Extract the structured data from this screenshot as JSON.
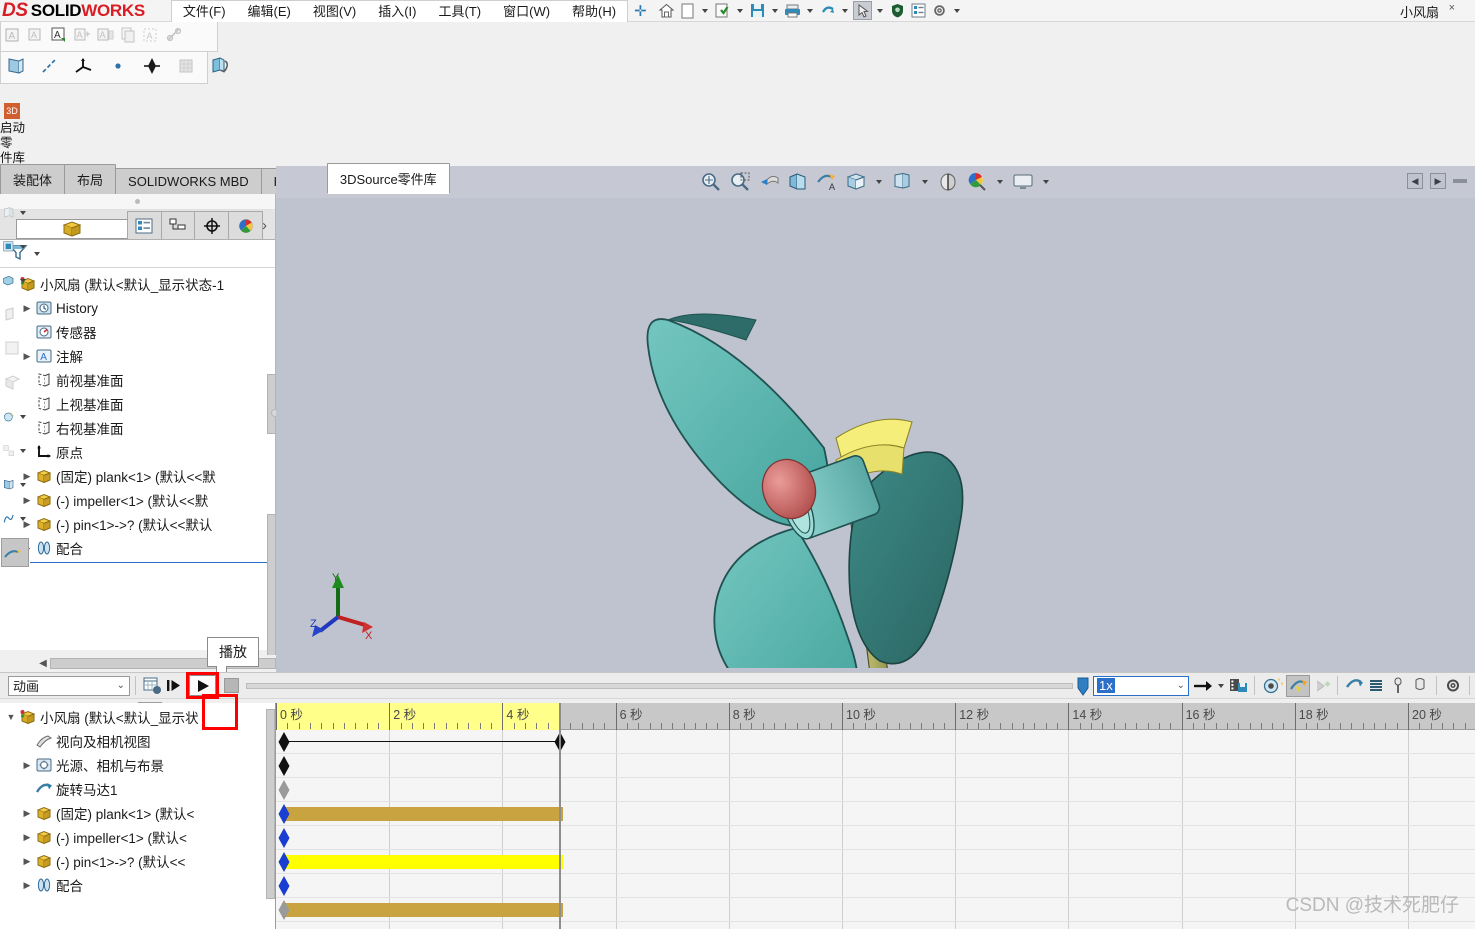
{
  "app": {
    "brand_ds": "DS",
    "brand_solid": "SOLID",
    "brand_works": "WORKS",
    "document_title": "小风扇",
    "close_label": "×",
    "accent_color": "#2a6fc9",
    "highlight_color": "#ff0000"
  },
  "menu": {
    "items": [
      {
        "label": "文件(F)",
        "name": "menu-file"
      },
      {
        "label": "编辑(E)",
        "name": "menu-edit"
      },
      {
        "label": "视图(V)",
        "name": "menu-view"
      },
      {
        "label": "插入(I)",
        "name": "menu-insert"
      },
      {
        "label": "工具(T)",
        "name": "menu-tools"
      },
      {
        "label": "窗口(W)",
        "name": "menu-window"
      },
      {
        "label": "帮助(H)",
        "name": "menu-help"
      }
    ]
  },
  "left_strip": {
    "badge": "3D",
    "label_line1": "启动零",
    "label_line2": "件库"
  },
  "tabs": [
    {
      "label": "装配体",
      "name": "tab-assembly",
      "active": false
    },
    {
      "label": "布局",
      "name": "tab-layout",
      "active": false
    },
    {
      "label": "SOLIDWORKS MBD",
      "name": "tab-solidworks-mbd",
      "active": false
    },
    {
      "label": "KYTool",
      "name": "tab-kytool",
      "active": false
    },
    {
      "label": "3DSource零件库",
      "name": "tab-3dsource-parts-library",
      "active": true
    }
  ],
  "feature_manager": {
    "tabs": [
      {
        "name": "fm-tab-feature-tree",
        "selected": true
      },
      {
        "name": "fm-tab-property-manager",
        "selected": false
      },
      {
        "name": "fm-tab-configuration-manager",
        "selected": false
      },
      {
        "name": "fm-tab-dimxpert-manager",
        "selected": false
      },
      {
        "name": "fm-tab-display-manager",
        "selected": false
      }
    ],
    "more_label": "›",
    "tree": [
      {
        "label": "小风扇  (默认<默认_显示状态-1",
        "indent": 0,
        "expander": "",
        "icon": "assembly-icon",
        "name": "tree-node-assembly-root"
      },
      {
        "label": "History",
        "indent": 1,
        "expander": "▶",
        "icon": "history-icon",
        "name": "tree-node-history"
      },
      {
        "label": "传感器",
        "indent": 1,
        "expander": "",
        "icon": "sensor-icon",
        "name": "tree-node-sensors"
      },
      {
        "label": "注解",
        "indent": 1,
        "expander": "▶",
        "icon": "annotation-icon",
        "name": "tree-node-annotations"
      },
      {
        "label": "前视基准面",
        "indent": 1,
        "expander": "",
        "icon": "plane-icon",
        "name": "tree-node-front-plane"
      },
      {
        "label": "上视基准面",
        "indent": 1,
        "expander": "",
        "icon": "plane-icon",
        "name": "tree-node-top-plane"
      },
      {
        "label": "右视基准面",
        "indent": 1,
        "expander": "",
        "icon": "plane-icon",
        "name": "tree-node-right-plane"
      },
      {
        "label": "原点",
        "indent": 1,
        "expander": "",
        "icon": "origin-icon",
        "name": "tree-node-origin"
      },
      {
        "label": "(固定) plank<1>  (默认<<默",
        "indent": 1,
        "expander": "▶",
        "icon": "part-icon",
        "name": "tree-node-plank"
      },
      {
        "label": "(-) impeller<1>  (默认<<默",
        "indent": 1,
        "expander": "▶",
        "icon": "part-icon",
        "name": "tree-node-impeller"
      },
      {
        "label": "(-) pin<1>->? (默认<<默认",
        "indent": 1,
        "expander": "▶",
        "icon": "part-icon",
        "name": "tree-node-pin"
      },
      {
        "label": "配合",
        "indent": 1,
        "expander": "▶",
        "icon": "mates-icon",
        "name": "tree-node-mates"
      }
    ]
  },
  "graphics": {
    "view_toolbar": [
      {
        "name": "zoom-to-fit-icon",
        "caret": false
      },
      {
        "name": "zoom-to-area-icon",
        "caret": false
      },
      {
        "name": "previous-view-icon",
        "caret": false
      },
      {
        "name": "section-view-icon",
        "caret": false
      },
      {
        "name": "view-orientation-icon",
        "caret": false
      },
      {
        "name": "display-style-icon",
        "caret": true
      },
      {
        "name": "hide-show-items-icon",
        "caret": true
      },
      {
        "name": "edit-appearance-icon",
        "caret": false
      },
      {
        "name": "apply-scene-icon",
        "caret": true
      },
      {
        "name": "view-settings-icon",
        "caret": true
      }
    ],
    "panel_controls": [
      {
        "name": "collapse-left-panel-button",
        "glyph": "◀"
      },
      {
        "name": "collapse-right-panel-button",
        "glyph": "▶"
      }
    ],
    "triad": {
      "x": "X",
      "y": "Y",
      "z": "Z"
    },
    "model": {
      "blade_color": "#5fb5b0",
      "blade_dark_color": "#2f6d6b",
      "hub_color": "#d4706e",
      "pole_color": "#9a9a52",
      "base_color": "#f2e96a",
      "background_color": "#bfc3cf"
    }
  },
  "tooltip": {
    "text": "播放"
  },
  "motion_manager": {
    "mode_dropdown": {
      "value": "动画",
      "caret": "⌄"
    },
    "speed_dropdown": {
      "value": "1x",
      "caret": "⌄"
    },
    "toolbar_buttons": [
      {
        "name": "calculate-button"
      },
      {
        "name": "play-from-start-button"
      },
      {
        "name": "play-button",
        "highlighted": true
      },
      {
        "name": "stop-button"
      }
    ],
    "right_buttons": [
      {
        "name": "playback-mode-button",
        "caret": true
      },
      {
        "name": "save-animation-button",
        "caret": false
      },
      {
        "name": "animation-wizard-button",
        "caret": false
      },
      {
        "name": "motor-button",
        "active": true
      },
      {
        "name": "spring-button",
        "active": false
      },
      {
        "name": "contact-button",
        "active": false
      },
      {
        "name": "gravity-button",
        "active": false
      },
      {
        "name": "damper-button",
        "active": false
      },
      {
        "name": "force-button",
        "active": false
      },
      {
        "name": "motion-study-properties-button",
        "active": false
      }
    ],
    "filter_buttons": [
      {
        "name": "filter-all-button",
        "active": true
      },
      {
        "name": "filter-animated-button",
        "active": false
      },
      {
        "name": "filter-driving-button",
        "active": false
      },
      {
        "name": "filter-selected-button",
        "active": false
      },
      {
        "name": "filter-results-button",
        "active": false
      }
    ],
    "tree": [
      {
        "label": "小风扇  (默认<默认_显示状",
        "indent": 0,
        "expander": "▼",
        "icon": "assembly-icon",
        "name": "mm-tree-node-assembly-root"
      },
      {
        "label": "视向及相机视图",
        "indent": 1,
        "expander": "",
        "icon": "orientation-camera-icon",
        "name": "mm-tree-node-orientation-camera-views"
      },
      {
        "label": "光源、相机与布景",
        "indent": 1,
        "expander": "▶",
        "icon": "lights-cameras-scene-icon",
        "name": "mm-tree-node-lights-cameras-scene"
      },
      {
        "label": "旋转马达1",
        "indent": 1,
        "expander": "",
        "icon": "rotary-motor-icon",
        "name": "mm-tree-node-rotary-motor-1"
      },
      {
        "label": "(固定) plank<1>  (默认<",
        "indent": 1,
        "expander": "▶",
        "icon": "part-icon",
        "name": "mm-tree-node-plank"
      },
      {
        "label": "(-) impeller<1>  (默认<",
        "indent": 1,
        "expander": "▶",
        "icon": "part-icon",
        "name": "mm-tree-node-impeller"
      },
      {
        "label": "(-) pin<1>->? (默认<<",
        "indent": 1,
        "expander": "▶",
        "icon": "part-icon",
        "name": "mm-tree-node-pin"
      },
      {
        "label": "配合",
        "indent": 1,
        "expander": "▶",
        "icon": "mates-icon",
        "name": "mm-tree-node-mates"
      }
    ]
  },
  "timeline": {
    "unit_suffix": "秒",
    "ticks": [
      {
        "label": "0 秒",
        "value": 0
      },
      {
        "label": "2 秒",
        "value": 2
      },
      {
        "label": "4 秒",
        "value": 4
      },
      {
        "label": "6 秒",
        "value": 6
      },
      {
        "label": "8 秒",
        "value": 8
      },
      {
        "label": "10 秒",
        "value": 10
      },
      {
        "label": "12 秒",
        "value": 12
      },
      {
        "label": "14 秒",
        "value": 14
      },
      {
        "label": "16 秒",
        "value": 16
      },
      {
        "label": "18 秒",
        "value": 18
      },
      {
        "label": "20 秒",
        "value": 20
      }
    ],
    "range_start": 0,
    "range_end": 20,
    "animation_end_time": 5,
    "time_marker": 5,
    "rows": [
      {
        "name": "tl-row-assembly-root",
        "diamond_start": "black",
        "diamond_end": "black",
        "connector": true,
        "bar": "none"
      },
      {
        "name": "tl-row-orientation-camera",
        "diamond_start": "black",
        "diamond_end": "none",
        "connector": false,
        "bar": "none"
      },
      {
        "name": "tl-row-lights-cameras",
        "diamond_start": "gray",
        "diamond_end": "none",
        "connector": false,
        "bar": "none"
      },
      {
        "name": "tl-row-rotary-motor",
        "diamond_start": "blue",
        "diamond_end": "none",
        "connector": false,
        "bar": "#c9a33f"
      },
      {
        "name": "tl-row-plank",
        "diamond_start": "blue",
        "diamond_end": "none",
        "connector": false,
        "bar": "none"
      },
      {
        "name": "tl-row-impeller",
        "diamond_start": "blue",
        "diamond_end": "none",
        "connector": false,
        "bar": "#ffff00"
      },
      {
        "name": "tl-row-pin",
        "diamond_start": "blue",
        "diamond_end": "none",
        "connector": false,
        "bar": "none"
      },
      {
        "name": "tl-row-mates",
        "diamond_start": "gray",
        "diamond_end": "none",
        "connector": false,
        "bar": "#c9a33f"
      }
    ]
  },
  "watermark": {
    "text": "CSDN @技术死肥仔"
  }
}
